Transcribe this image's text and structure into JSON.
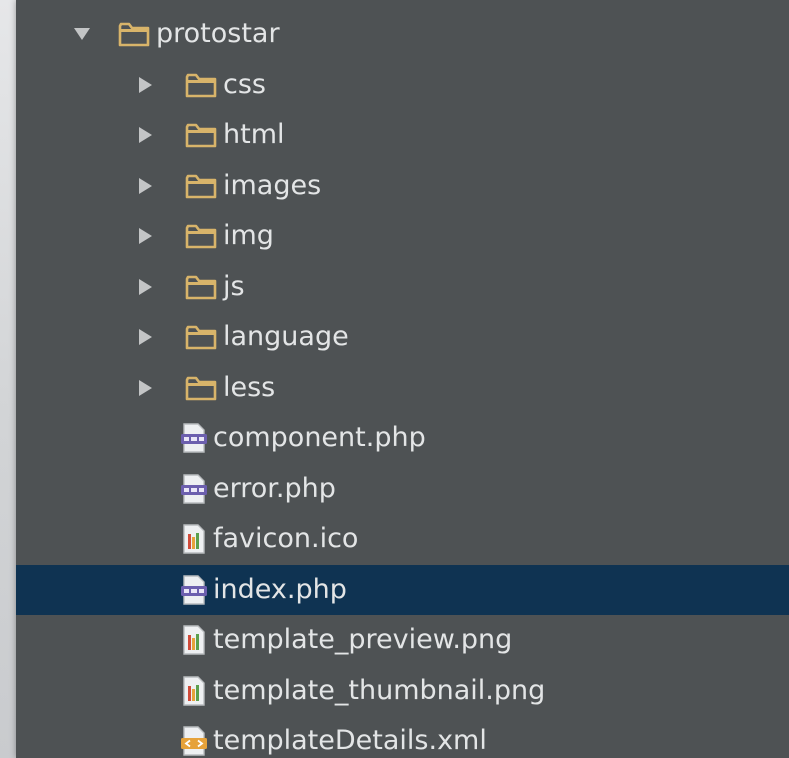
{
  "tree": {
    "items": [
      {
        "label": "protostar",
        "type": "folder",
        "expanded": true,
        "depth": 0,
        "icon": "folder-icon"
      },
      {
        "label": "css",
        "type": "folder",
        "expanded": false,
        "depth": 1,
        "icon": "folder-icon"
      },
      {
        "label": "html",
        "type": "folder",
        "expanded": false,
        "depth": 1,
        "icon": "folder-icon"
      },
      {
        "label": "images",
        "type": "folder",
        "expanded": false,
        "depth": 1,
        "icon": "folder-icon"
      },
      {
        "label": "img",
        "type": "folder",
        "expanded": false,
        "depth": 1,
        "icon": "folder-icon"
      },
      {
        "label": "js",
        "type": "folder",
        "expanded": false,
        "depth": 1,
        "icon": "folder-icon"
      },
      {
        "label": "language",
        "type": "folder",
        "expanded": false,
        "depth": 1,
        "icon": "folder-icon"
      },
      {
        "label": "less",
        "type": "folder",
        "expanded": false,
        "depth": 1,
        "icon": "folder-icon"
      },
      {
        "label": "component.php",
        "type": "file",
        "depth": 1,
        "icon": "php-file-icon"
      },
      {
        "label": "error.php",
        "type": "file",
        "depth": 1,
        "icon": "php-file-icon"
      },
      {
        "label": "favicon.ico",
        "type": "file",
        "depth": 1,
        "icon": "image-file-icon"
      },
      {
        "label": "index.php",
        "type": "file",
        "depth": 1,
        "icon": "php-file-icon",
        "selected": true
      },
      {
        "label": "template_preview.png",
        "type": "file",
        "depth": 1,
        "icon": "image-file-icon"
      },
      {
        "label": "template_thumbnail.png",
        "type": "file",
        "depth": 1,
        "icon": "image-file-icon"
      },
      {
        "label": "templateDetails.xml",
        "type": "file",
        "depth": 1,
        "icon": "xml-file-icon"
      }
    ]
  },
  "colors": {
    "panel_bg": "#4e5254",
    "selection_bg": "#0f3352",
    "text": "#e3e5e6",
    "folder": "#d8b46a",
    "php_badge": "#6c5fae"
  }
}
